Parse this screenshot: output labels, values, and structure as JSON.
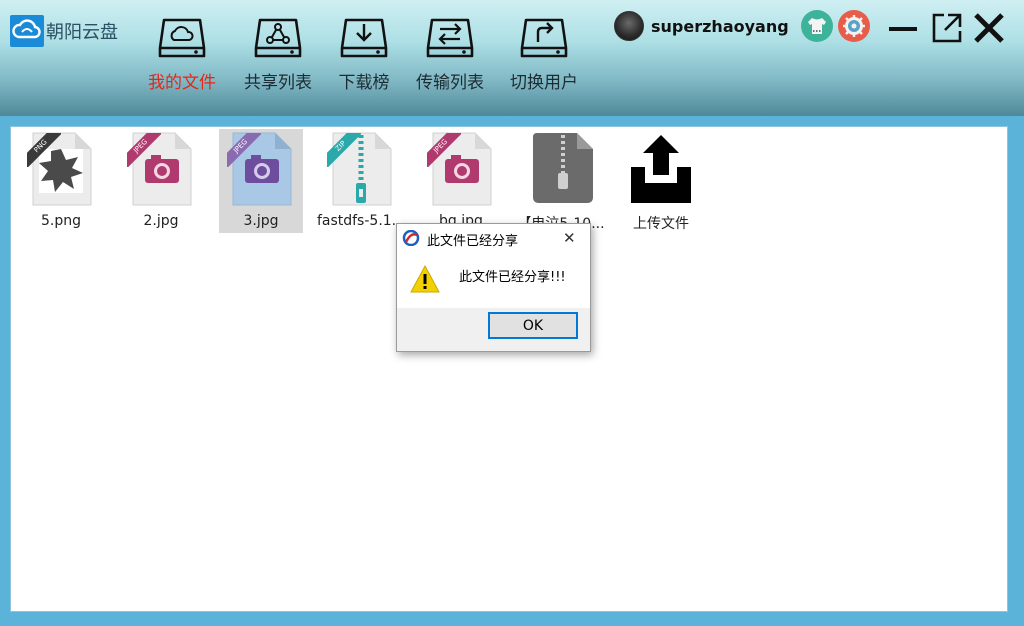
{
  "app": {
    "title": "朝阳云盘"
  },
  "nav": {
    "items": [
      {
        "label": "我的文件",
        "icon": "cloud-drive-icon",
        "active": true
      },
      {
        "label": "共享列表",
        "icon": "share-drive-icon",
        "active": false
      },
      {
        "label": "下载榜",
        "icon": "download-drive-icon",
        "active": false
      },
      {
        "label": "传输列表",
        "icon": "transfer-drive-icon",
        "active": false
      },
      {
        "label": "切换用户",
        "icon": "switch-user-drive-icon",
        "active": false
      }
    ]
  },
  "user": {
    "name": "superzhaoyang"
  },
  "files": [
    {
      "name": "5.png",
      "type": "PNG",
      "tag_color": "#3a3a3a"
    },
    {
      "name": "2.jpg",
      "type": "JPEG",
      "tag_color": "#b03a6e"
    },
    {
      "name": "3.jpg",
      "type": "JPEG",
      "tag_color": "#8a6ab0",
      "selected": true
    },
    {
      "name": "fastdfs-5.1...",
      "type": "ZIP",
      "tag_color": "#29a9a9"
    },
    {
      "name": "bg.jpg",
      "type": "JPEG",
      "tag_color": "#b03a6e"
    },
    {
      "name": "【电泣5-10...",
      "type": "archive"
    }
  ],
  "upload": {
    "label": "上传文件"
  },
  "dialog": {
    "title": "此文件已经分享",
    "message": "此文件已经分享!!!",
    "ok_label": "OK",
    "close_glyph": "✕"
  },
  "colors": {
    "accent": "#1b8ad7",
    "active_nav": "#e0281b",
    "dialog_focus": "#0078d7"
  }
}
